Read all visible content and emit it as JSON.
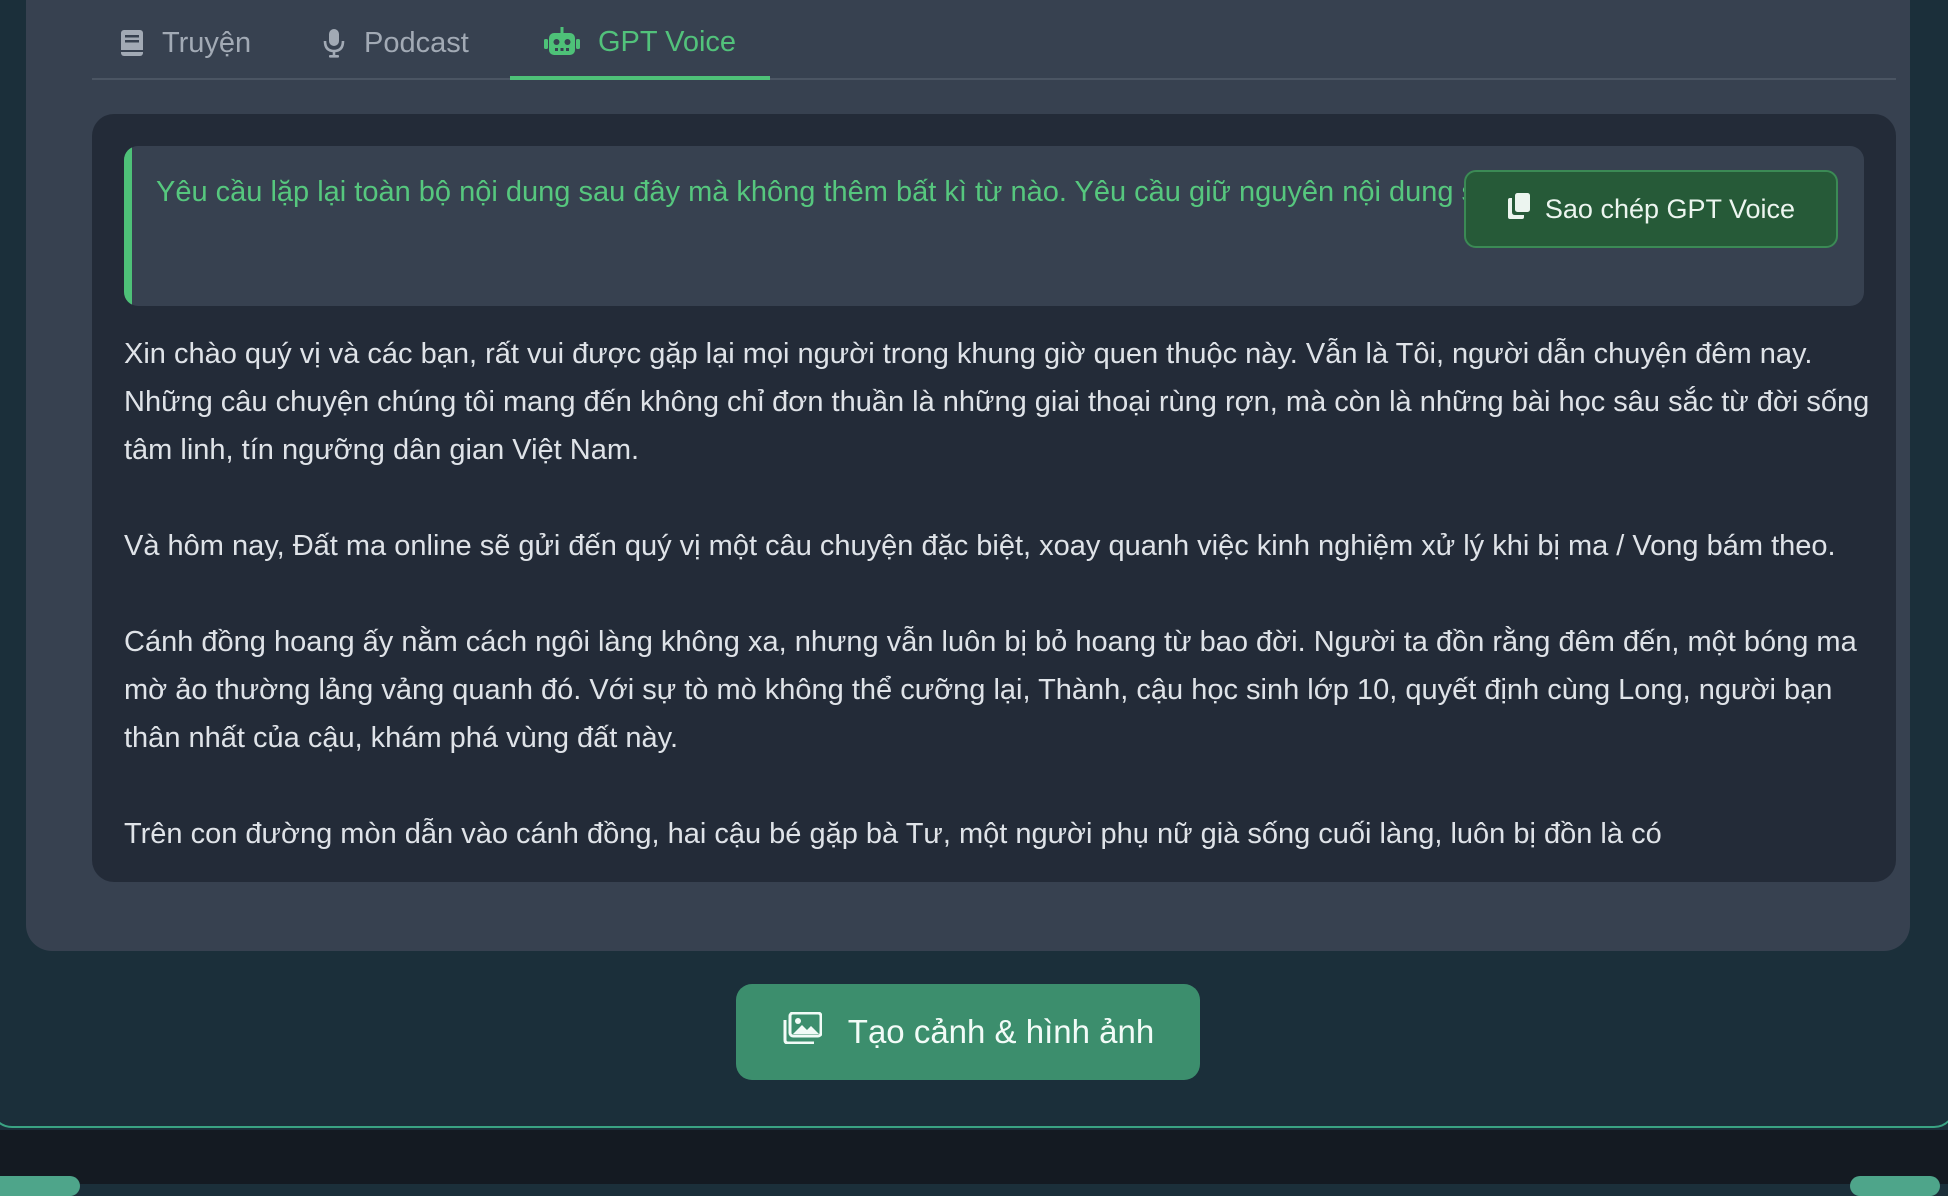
{
  "tabs": [
    {
      "label": "Truyện",
      "icon": "book-icon",
      "active": false
    },
    {
      "label": "Podcast",
      "icon": "microphone-icon",
      "active": false
    },
    {
      "label": "GPT Voice",
      "icon": "robot-icon",
      "active": true
    }
  ],
  "prompt": {
    "text": "Yêu cầu lặp lại toàn bộ nội dung sau đây mà không thêm bất kì từ nào. Yêu cầu giữ nguyên nội dung sau:"
  },
  "copy_button": {
    "label": "Sao chép GPT Voice",
    "icon": "copy-icon"
  },
  "script_paragraphs": [
    "Xin chào quý vị và các bạn, rất vui được gặp lại mọi người trong khung giờ quen thuộc này. Vẫn là Tôi, người dẫn chuyện đêm nay. Những câu chuyện chúng tôi mang đến không chỉ đơn thuần là những giai thoại rùng rợn, mà còn là những bài học sâu sắc từ đời sống tâm linh, tín ngưỡng dân gian Việt Nam.",
    "Và hôm nay, Đất ma online sẽ gửi đến quý vị một câu chuyện đặc biệt, xoay quanh việc kinh nghiệm xử lý khi bị ma / Vong bám theo.",
    "Cánh đồng hoang ấy nằm cách ngôi làng không xa, nhưng vẫn luôn bị bỏ hoang từ bao đời. Người ta đồn rằng đêm đến, một bóng ma mờ ảo thường lảng vảng quanh đó. Với sự tò mò không thể cưỡng lại, Thành, cậu học sinh lớp 10, quyết định cùng Long, người bạn thân nhất của cậu, khám phá vùng đất này.",
    "Trên con đường mòn dẫn vào cánh đồng, hai cậu bé gặp bà Tư, một người phụ nữ già sống cuối làng, luôn bị đồn là có"
  ],
  "action_button": {
    "label": "Tạo cảnh & hình ảnh",
    "icon": "images-icon"
  },
  "colors": {
    "accent": "#4ec178",
    "card": "#374150",
    "panel": "#232b38",
    "action": "#3c8e6d",
    "background": "#1b2f3a"
  }
}
